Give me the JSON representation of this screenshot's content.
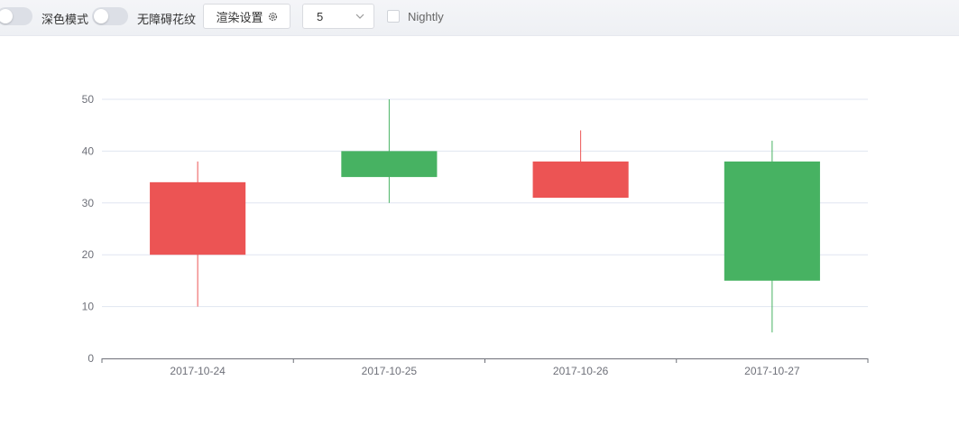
{
  "toolbar": {
    "dark_mode_label": "深色模式",
    "aria_pattern_label": "无障碍花纹",
    "render_settings_label": "渲染设置",
    "select_value": "5",
    "nightly_label": "Nightly"
  },
  "chart_data": {
    "type": "candlestick",
    "title": "",
    "xlabel": "",
    "ylabel": "",
    "ylim": [
      0,
      50
    ],
    "yticks": [
      "0",
      "10",
      "20",
      "30",
      "40",
      "50"
    ],
    "categories": [
      "2017-10-24",
      "2017-10-25",
      "2017-10-26",
      "2017-10-27"
    ],
    "series": [
      {
        "values": [
          {
            "open": 20,
            "close": 34,
            "low": 10,
            "high": 38
          },
          {
            "open": 40,
            "close": 35,
            "low": 30,
            "high": 50
          },
          {
            "open": 31,
            "close": 38,
            "low": 33,
            "high": 44
          },
          {
            "open": 38,
            "close": 15,
            "low": 5,
            "high": 42
          }
        ]
      }
    ],
    "up_color": "#ec5454",
    "down_color": "#47b262",
    "grid": true,
    "legend": "none"
  }
}
